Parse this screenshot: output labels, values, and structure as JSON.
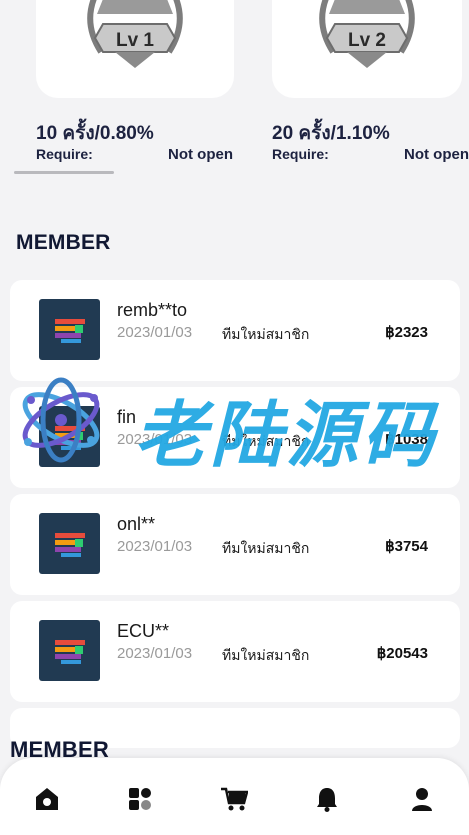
{
  "levels": [
    {
      "badge": "Lv 1",
      "rate": "10 ครั้ง/0.80%",
      "require_label": "Require:",
      "status": "Not open"
    },
    {
      "badge": "Lv 2",
      "rate": "20 ครั้ง/1.10%",
      "require_label": "Require:",
      "status": "Not open"
    }
  ],
  "member_section": {
    "title": "MEMBER"
  },
  "members": [
    {
      "name": "remb**to",
      "date": "2023/01/03",
      "type": "ทีมใหม่สมาชิก",
      "amount": "฿2323"
    },
    {
      "name": "fin",
      "date": "2023/01/03",
      "type": "ทีมใหม่สมาชิก",
      "amount": "฿1038"
    },
    {
      "name": "onl**",
      "date": "2023/01/03",
      "type": "ทีมใหม่สมาชิก",
      "amount": "฿3754"
    },
    {
      "name": "ECU**",
      "date": "2023/01/03",
      "type": "ทีมใหม่สมาชิก",
      "amount": "฿20543"
    }
  ],
  "member_section_2": {
    "title": "MEMBER"
  },
  "watermark": {
    "text": "老陆源码"
  },
  "nav": [
    {
      "icon": "home-icon"
    },
    {
      "icon": "grid-icon"
    },
    {
      "icon": "cart-icon"
    },
    {
      "icon": "bell-icon"
    },
    {
      "icon": "user-icon"
    }
  ]
}
